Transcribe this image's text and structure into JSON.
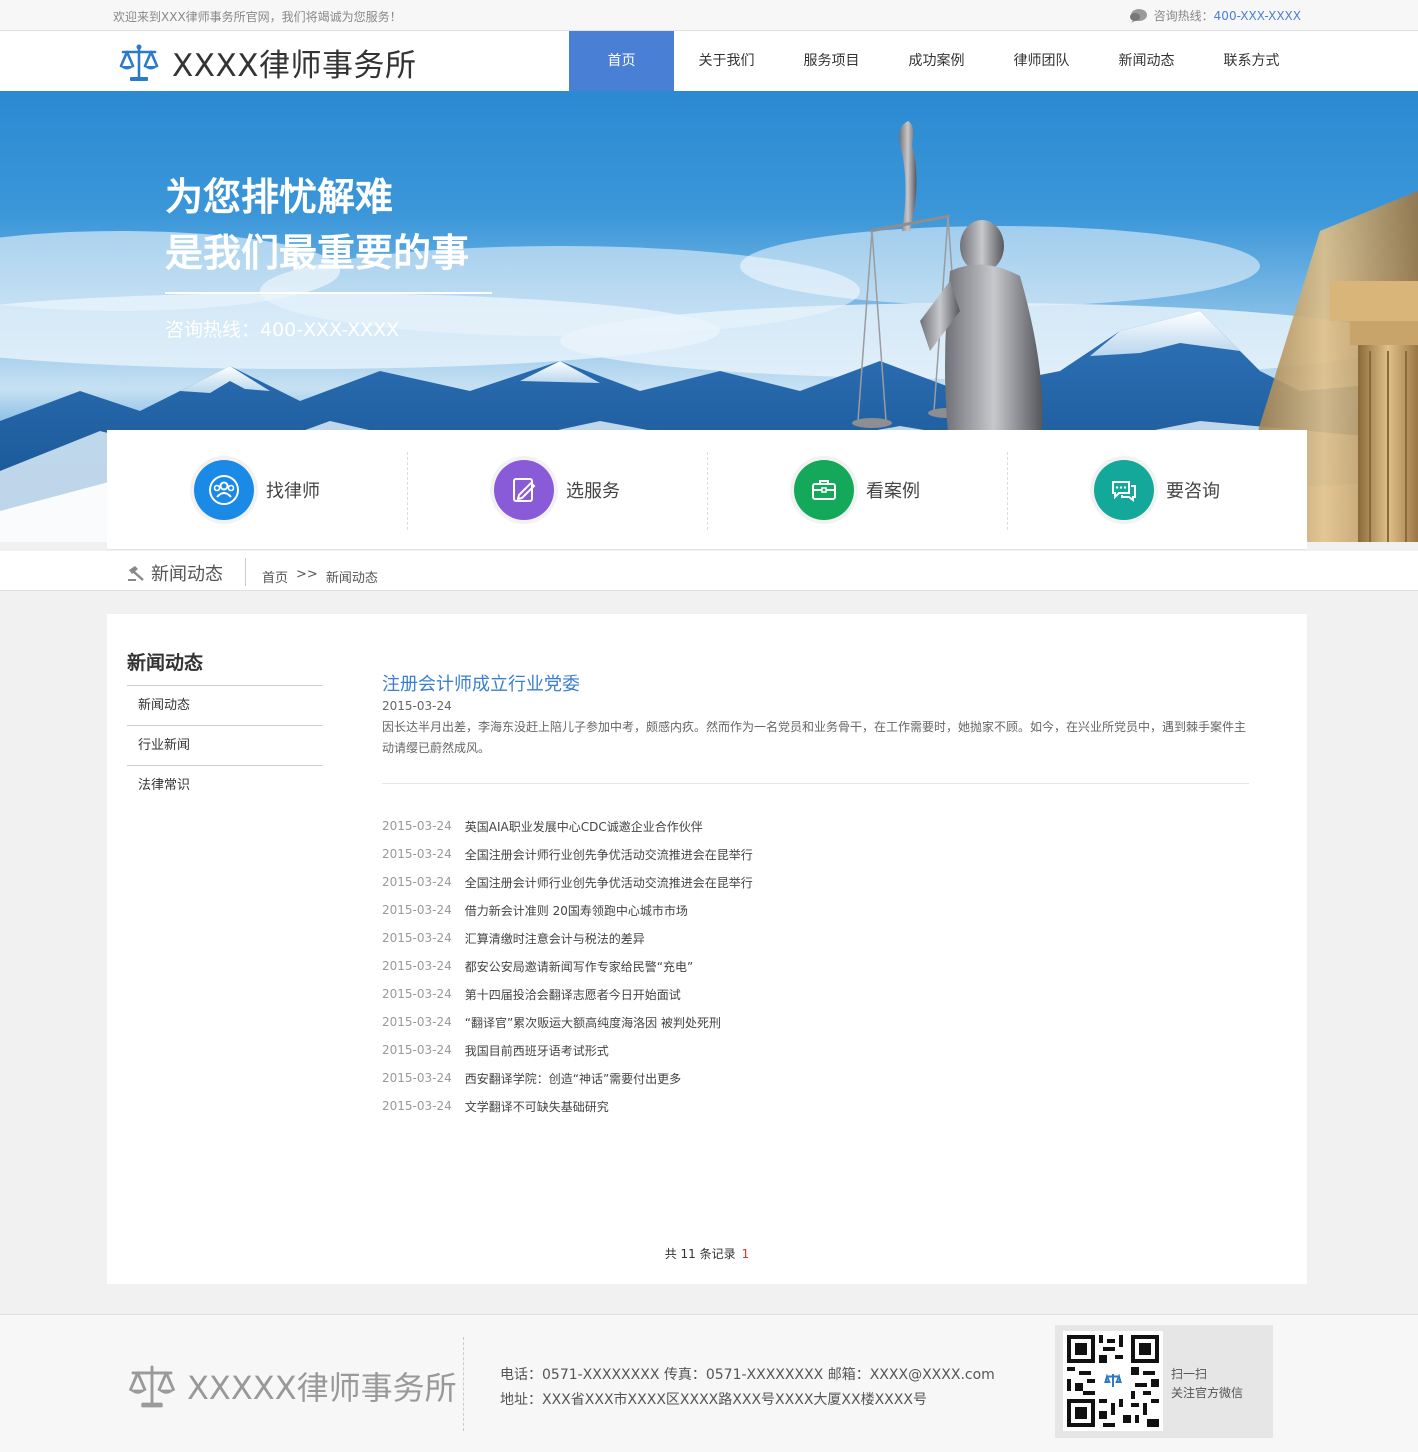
{
  "topbar": {
    "welcome": "欢迎来到XXX律师事务所官网，我们将竭诚为您服务！",
    "hotline_label": "咨询热线：",
    "hotline_number": "400-XXX-XXXX"
  },
  "header": {
    "logo_text": "XXXX律师事务所",
    "nav": [
      "首页",
      "关于我们",
      "服务项目",
      "成功案例",
      "律师团队",
      "新闻动态",
      "联系方式"
    ],
    "active_index": 0,
    "accent_color": "#4a7fd6"
  },
  "banner": {
    "headline_1": "为您排忧解难",
    "headline_2": "是我们最重要的事",
    "hotline": "咨询热线：400-XXX-XXXX"
  },
  "quick_links": [
    {
      "label": "找律师",
      "icon": "users-icon",
      "color": "#1a8ae6"
    },
    {
      "label": "选服务",
      "icon": "edit-document-icon",
      "color": "#8a5bd9"
    },
    {
      "label": "看案例",
      "icon": "briefcase-icon",
      "color": "#14a85a"
    },
    {
      "label": "要咨询",
      "icon": "chat-bubbles-icon",
      "color": "#14a89a"
    }
  ],
  "crumb": {
    "section_title": "新闻动态",
    "home": "首页",
    "separator": ">>",
    "current": "新闻动态"
  },
  "sidebar": {
    "title": "新闻动态",
    "items": [
      "新闻动态",
      "行业新闻",
      "法律常识"
    ]
  },
  "featured": {
    "title": "注册会计师成立行业党委",
    "date": "2015-03-24",
    "summary": "因长达半月出差，李海东没赶上陪儿子参加中考，颇感内疚。然而作为一名党员和业务骨干，在工作需要时，她抛家不顾。如今，在兴业所党员中，遇到棘手案件主动请缨已蔚然成风。"
  },
  "news": [
    {
      "date": "2015-03-24",
      "title": "英国AIA职业发展中心CDC诚邀企业合作伙伴"
    },
    {
      "date": "2015-03-24",
      "title": "全国注册会计师行业创先争优活动交流推进会在昆举行"
    },
    {
      "date": "2015-03-24",
      "title": "全国注册会计师行业创先争优活动交流推进会在昆举行"
    },
    {
      "date": "2015-03-24",
      "title": "借力新会计准则 20国寿领跑中心城市市场"
    },
    {
      "date": "2015-03-24",
      "title": "汇算清缴时注意会计与税法的差异"
    },
    {
      "date": "2015-03-24",
      "title": "都安公安局邀请新闻写作专家给民警“充电”"
    },
    {
      "date": "2015-03-24",
      "title": "第十四届投洽会翻译志愿者今日开始面试"
    },
    {
      "date": "2015-03-24",
      "title": "“翻译官”累次贩运大额高纯度海洛因 被判处死刑"
    },
    {
      "date": "2015-03-24",
      "title": "我国目前西班牙语考试形式"
    },
    {
      "date": "2015-03-24",
      "title": "西安翻译学院：创造“神话”需要付出更多"
    },
    {
      "date": "2015-03-24",
      "title": "文学翻译不可缺失基础研究"
    }
  ],
  "pager": {
    "summary": "共 11 条记录",
    "current_page": "1"
  },
  "footer": {
    "logo_text": "XXXXX律师事务所",
    "contact_line": "电话：0571-XXXXXXXX  传真：0571-XXXXXXXX  邮箱：XXXX@XXXX.com",
    "address_line": "地址：XXX省XXX市XXXX区XXXX路XXX号XXXX大厦XX楼XXXX号",
    "qr_line1": "扫一扫",
    "qr_line2": "关注官方微信"
  }
}
